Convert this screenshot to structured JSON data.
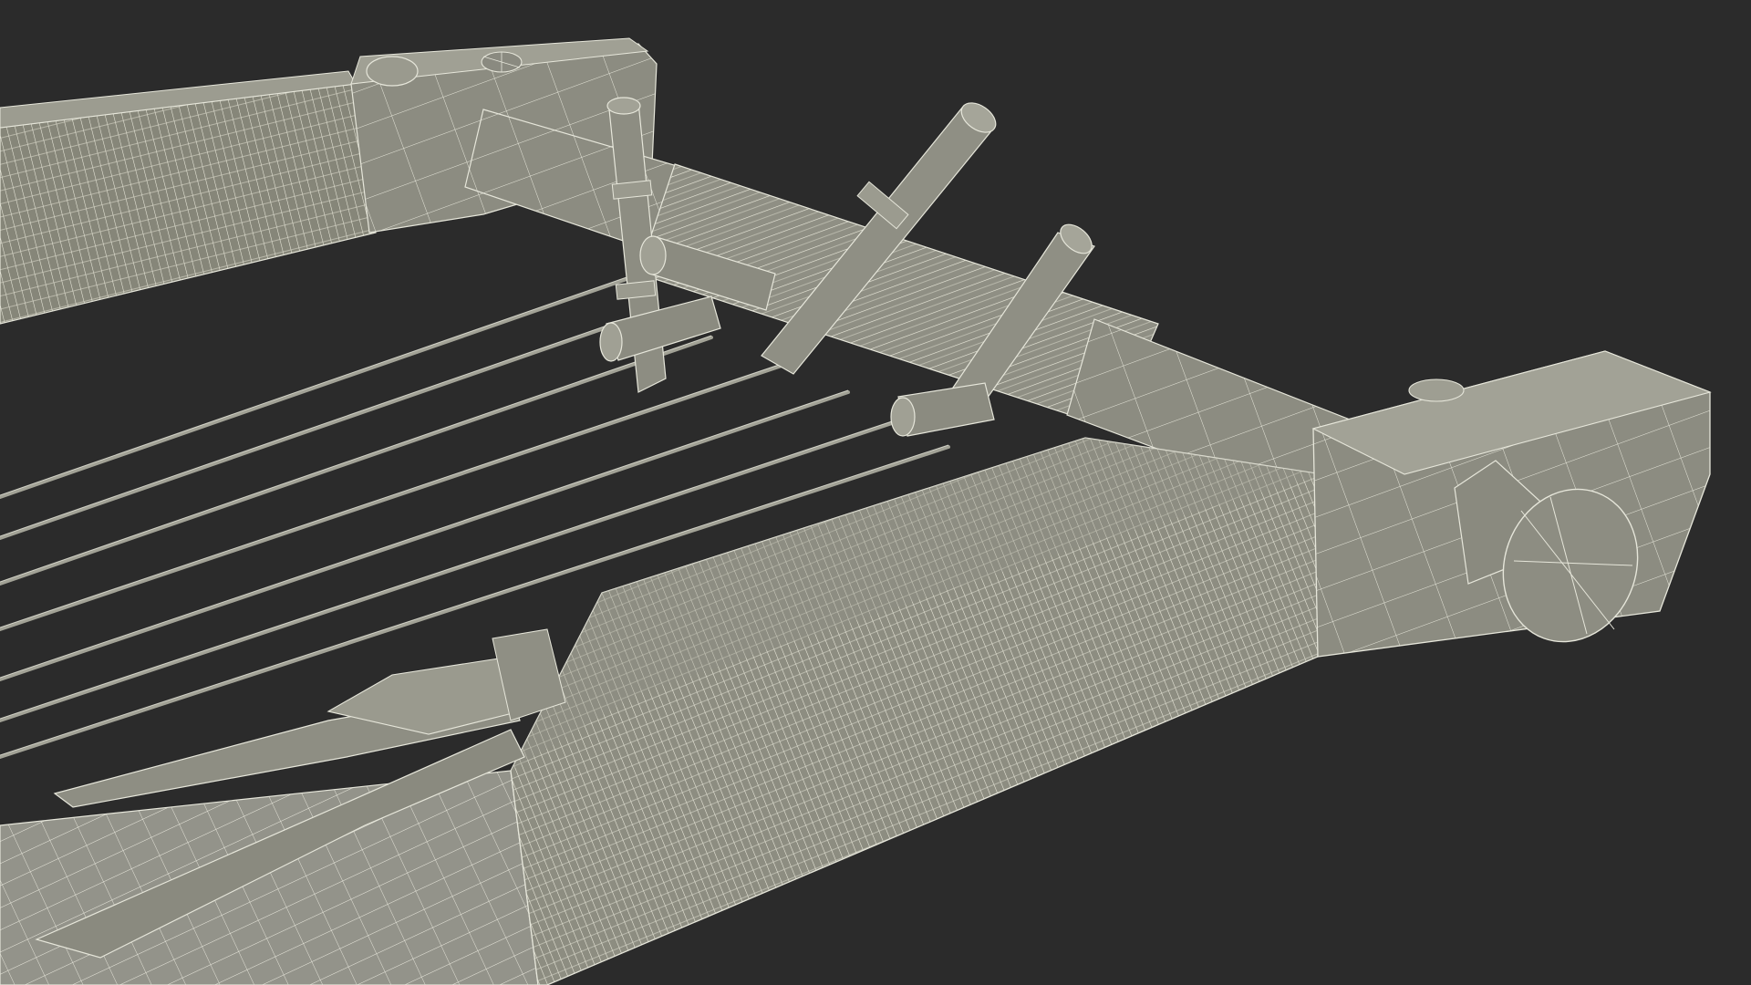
{
  "viewport": {
    "background_color": "#2b2b2b",
    "mesh_fill_color": "#8a8a80",
    "mesh_shade_color": "#6f6f66",
    "mesh_light_color": "#a3a398",
    "wire_color": "#e6e6da",
    "string_color": "#9a9a8f",
    "render_mode": "wireframe-on-shaded",
    "subject_icon": "wrapped-frame-with-strings"
  }
}
